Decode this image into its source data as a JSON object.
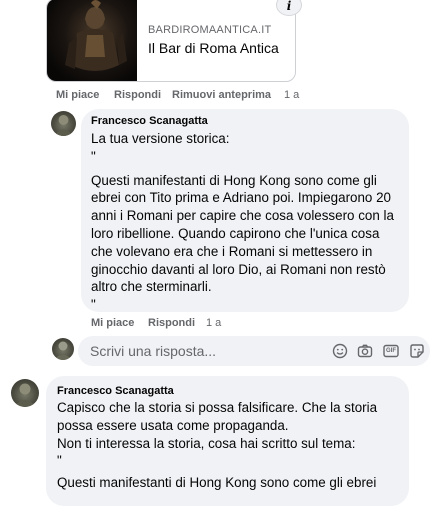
{
  "link_preview": {
    "domain": "BARDIROMAANTICA.IT",
    "title": "Il Bar di Roma Antica",
    "info_icon": "i"
  },
  "post_actions": {
    "like": "Mi piace",
    "reply": "Rispondi",
    "remove_preview": "Rimuovi anteprima",
    "time": "1 a"
  },
  "comment1": {
    "author": "Francesco Scanagatta",
    "lines": [
      "La tua versione storica:",
      "\"",
      "Questi manifestanti di Hong Kong sono come gli",
      "ebrei con Tito prima e Adriano poi. Impiegarono 20",
      "anni i Romani per capire che cosa volessero con la",
      "loro ribellione. Quando capirono che l'unica cosa",
      "che volevano era che i Romani si mettessero in",
      "ginocchio davanti al loro Dio, ai Romani non restò",
      "altro che sterminarli.",
      "\""
    ],
    "actions": {
      "like": "Mi piace",
      "reply": "Rispondi",
      "time": "1 a"
    }
  },
  "reply_box": {
    "placeholder": "Scrivi una risposta...",
    "icons": [
      "emoji-icon",
      "camera-icon",
      "gif-icon",
      "sticker-icon"
    ],
    "gif_label": "GIF"
  },
  "comment2": {
    "author": "Francesco Scanagatta",
    "lines": [
      "Capisco che la storia si possa falsificare. Che la storia",
      "possa essere usata come propaganda.",
      "Non ti interessa la storia, cosa hai scritto sul tema:",
      "\"",
      "Questi manifestanti di Hong Kong sono come gli ebrei"
    ]
  },
  "colors": {
    "bubble": "#f0f2f5",
    "secondary_text": "#65676b",
    "primary_text": "#050505"
  }
}
